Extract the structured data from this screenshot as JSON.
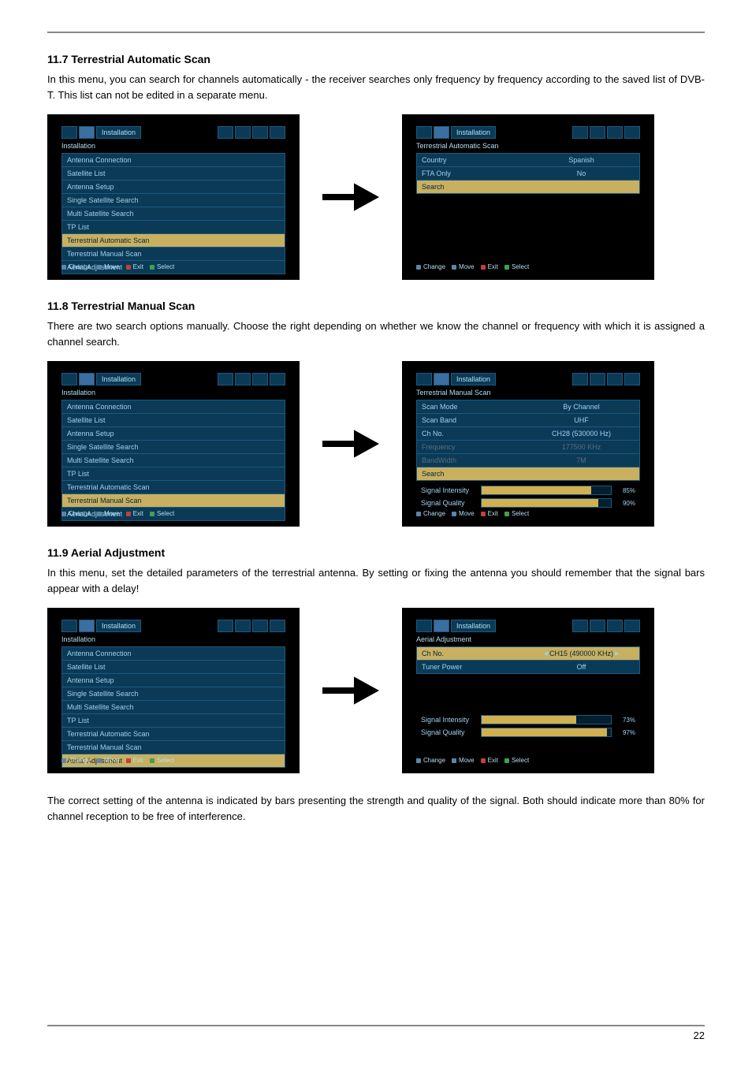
{
  "page_number": "22",
  "sec1": {
    "heading": "11.7 Terrestrial Automatic Scan",
    "para": "In this menu, you can search for channels automatically - the receiver searches only frequency by frequency according to the saved list of DVB-T. This list can not be edited in a separate menu."
  },
  "sec2": {
    "heading": "11.8 Terrestrial Manual Scan",
    "para": "There are two search options manually. Choose the right depending on whether we know the channel or frequency with which it is assigned a channel search."
  },
  "sec3": {
    "heading": "11.9 Aerial Adjustment",
    "para": "In this menu, set the detailed parameters of the terrestrial antenna. By setting or fixing the antenna you should remember that the signal bars appear with a delay!",
    "para2": "The correct setting of the antenna is indicated by bars presenting the strength and quality of the signal. Both should indicate more than 80% for channel reception to be free of interference."
  },
  "menu": {
    "topTitle": "Installation",
    "header": "Installation",
    "items": [
      "Antenna Connection",
      "Satellite List",
      "Antenna Setup",
      "Single Satellite Search",
      "Multi Satellite Search",
      "TP List",
      "Terrestrial Automatic Scan",
      "Terrestrial Manual Scan",
      "Aerial Adjustment"
    ]
  },
  "footer": {
    "change": "Change",
    "move": "Move",
    "exit": "Exit",
    "select": "Select"
  },
  "autoScan": {
    "header": "Terrestrial Automatic Scan",
    "rows": [
      {
        "label": "Country",
        "value": "Spanish"
      },
      {
        "label": "FTA Only",
        "value": "No"
      },
      {
        "label": "Search",
        "value": "",
        "hl": true
      }
    ]
  },
  "manualScan": {
    "header": "Terrestrial Manual Scan",
    "rows": [
      {
        "label": "Scan Mode",
        "value": "By Channel"
      },
      {
        "label": "Scan Band",
        "value": "UHF"
      },
      {
        "label": "Ch No.",
        "value": "CH28 (530000 Hz)"
      },
      {
        "label": "Frequency",
        "value": "177500 KHz",
        "dim": true
      },
      {
        "label": "BandWidth",
        "value": "7M",
        "dim": true
      },
      {
        "label": "Search",
        "value": "",
        "hl": true
      }
    ],
    "signals": [
      {
        "label": "Signal Intensity",
        "pct": "85%",
        "w": "85%"
      },
      {
        "label": "Signal Quality",
        "pct": "90%",
        "w": "90%"
      }
    ]
  },
  "aerial": {
    "header": "Aerial Adjustment",
    "rows": [
      {
        "label": "Ch No.",
        "value": "CH15 (490000 KHz)",
        "hl": true,
        "sel": true
      },
      {
        "label": "Tuner Power",
        "value": "Off"
      }
    ],
    "signals": [
      {
        "label": "Signal Intensity",
        "pct": "73%",
        "w": "73%"
      },
      {
        "label": "Signal Quality",
        "pct": "97%",
        "w": "97%"
      }
    ]
  }
}
